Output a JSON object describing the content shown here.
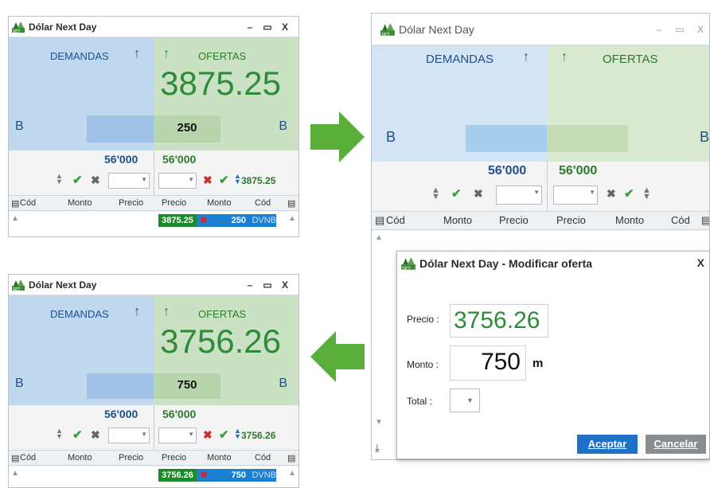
{
  "window_title": "Dólar Next Day",
  "window_controls": {
    "minimize": "–",
    "maximize": "▭",
    "close": "X"
  },
  "labels": {
    "demandas": "DEMANDAS",
    "ofertas": "OFERTAS",
    "b": "B",
    "arrow_up": "↑"
  },
  "volumes": {
    "bid": "56'000",
    "ask": "56'000"
  },
  "columns": {
    "cod_left": "Cód",
    "monto": "Monto",
    "precio": "Precio",
    "cod_right": "Cód"
  },
  "panel_before": {
    "price": "3875.25",
    "bar_value": "250",
    "ctrl_price": "3875.25",
    "order": {
      "precio": "3875.25",
      "monto": "250",
      "cod": "DVNB"
    }
  },
  "panel_editing": {
    "modal": {
      "title": "Dólar Next Day - Modificar oferta",
      "close": "X",
      "precio_label": "Precio :",
      "precio_value": "3756.26",
      "monto_label": "Monto :",
      "monto_value": "750",
      "monto_unit": "m",
      "total_label": "Total :",
      "accept": "Aceptar",
      "cancel": "Cancelar"
    }
  },
  "panel_after": {
    "price": "3756.26",
    "bar_value": "750",
    "ctrl_price": "3756.26",
    "order": {
      "precio": "3756.26",
      "monto": "750",
      "cod": "DVNB"
    }
  },
  "icons": [
    "logo-icon",
    "minimize-icon",
    "maximize-icon",
    "close-icon",
    "up-arrow-icon",
    "updown-icon",
    "check-icon",
    "x-icon",
    "dropdown-icon",
    "list-icon",
    "download-icon",
    "right-arrow-icon",
    "left-arrow-icon"
  ],
  "colors": {
    "bid_blue": "#bfd8ee",
    "ask_green": "#cbe1c3",
    "price_green": "#2e8b3a",
    "accept_blue": "#1d72c8",
    "arrow_green": "#5aae3a"
  }
}
